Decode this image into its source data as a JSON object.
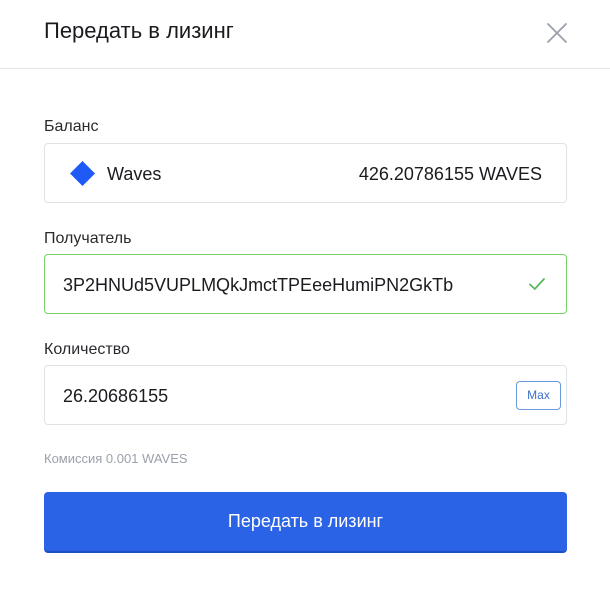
{
  "dialog": {
    "title": "Передать в лизинг"
  },
  "icons": {
    "close": "close-icon",
    "asset": "waves-diamond-icon",
    "valid": "checkmark-icon"
  },
  "balance": {
    "label": "Баланс",
    "asset_name": "Waves",
    "value": "426.20786155 WAVES"
  },
  "recipient": {
    "label": "Получатель",
    "value": "3P2HNUd5VUPLMQkJmctTPEeeHumiPN2GkTb"
  },
  "amount": {
    "label": "Количество",
    "value": "26.20686155",
    "max_label": "Max"
  },
  "fee_text": "Комиссия 0.001 WAVES",
  "submit_label": "Передать в лизинг",
  "colors": {
    "primary": "#2a63e6",
    "waves_icon": "#1f5af6",
    "valid_border": "#7bcf6b",
    "check": "#5cb85c"
  }
}
